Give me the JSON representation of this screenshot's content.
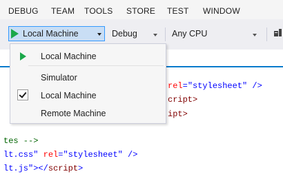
{
  "menu": [
    "DEBUG",
    "TEAM",
    "TOOLS",
    "STORE",
    "TEST",
    "WINDOW"
  ],
  "toolbar": {
    "run_target": "Local Machine",
    "configuration": "Debug",
    "platform": "Any CPU"
  },
  "dropdown": {
    "header_item": "Local Machine",
    "items": [
      "Simulator",
      "Local Machine",
      "Remote Machine"
    ],
    "checked_item": "Local Machine"
  },
  "code": {
    "line1_attr": "rel",
    "line1_eq": "=",
    "line1_val": "\"stylesheet\"",
    "line1_end": " />",
    "line2": "cript>",
    "line3": "ipt>",
    "line4": "tes -->",
    "line5_a": "lt.css\"",
    "line5_attr": " rel",
    "line5_eq": "=",
    "line5_val": "\"stylesheet\"",
    "line5_end": " />",
    "line6_a": "lt.js\"",
    "line6_b": "></",
    "line6_tag": "script",
    "line6_c": ">"
  },
  "colors": {
    "accent": "#007acc",
    "play_green": "#1ba84a",
    "selection": "#c9def5"
  }
}
